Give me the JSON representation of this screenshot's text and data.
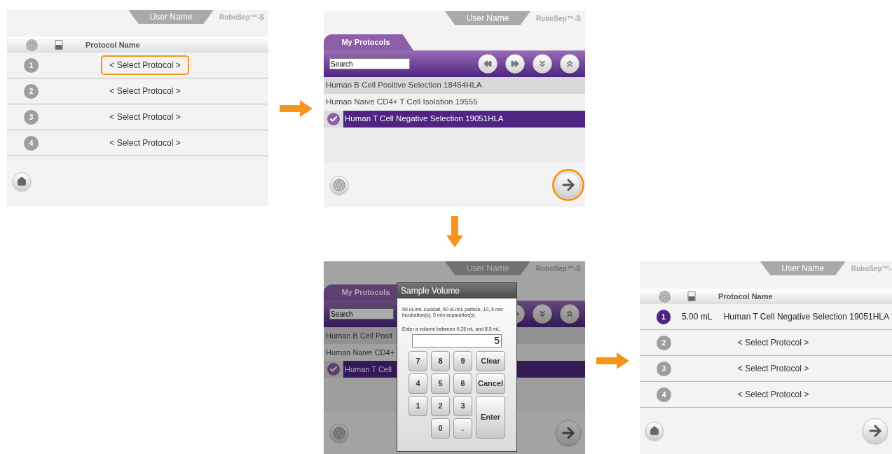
{
  "screens": [
    {
      "kind": "carousel",
      "user_name": "User Name",
      "product": "RoboSep™-S",
      "column": "Protocol Name",
      "next_button": false,
      "rows": [
        {
          "number": "1",
          "protocol": "< Select Protocol >",
          "selected": false,
          "highlighted": true
        },
        {
          "number": "2",
          "protocol": "< Select Protocol >",
          "selected": false,
          "highlighted": false
        },
        {
          "number": "3",
          "protocol": "< Select Protocol >",
          "selected": false,
          "highlighted": false
        },
        {
          "number": "4",
          "protocol": "< Select Protocol >",
          "selected": false,
          "highlighted": false
        }
      ]
    },
    {
      "kind": "browser",
      "user_name": "User Name",
      "product": "RoboSep™-S",
      "tab": "My Protocols",
      "search": {
        "placeholder": "Search"
      },
      "next_highlighted": true,
      "protocols": [
        {
          "name": "Human B Cell Positive Selection 18454HLA",
          "selected": false
        },
        {
          "name": "Human Naive CD4+ T Cell Isolation 19555",
          "selected": false
        },
        {
          "name": "Human T Cell Negative Selection 19051HLA",
          "selected": true
        }
      ]
    },
    {
      "kind": "browser",
      "user_name": "User Name",
      "product": "RoboSep™-S",
      "tab": "My Protocols",
      "search": {
        "placeholder": "Search"
      },
      "next_highlighted": false,
      "protocols": [
        {
          "name": "Human B Cell Posit",
          "selected": false
        },
        {
          "name": "Human Naive CD4+",
          "selected": false
        },
        {
          "name": "Human T Cell",
          "selected": true
        }
      ],
      "dialog": {
        "title": "Sample Volume",
        "description": "50 uL/mL cocktail, 50 uL/mL particle, 10, 5 min incubation(s), 5 min separation(s)",
        "prompt": "Enter a volume between 0.25 mL and 8.5 mL",
        "value": "5",
        "digit_keys": [
          [
            "7",
            "8",
            "9"
          ],
          [
            "4",
            "5",
            "6"
          ],
          [
            "1",
            "2",
            "3"
          ],
          [
            "0",
            "."
          ]
        ],
        "action_keys": [
          {
            "label": "Clear",
            "kind": "small"
          },
          {
            "label": "Cancel",
            "kind": "small"
          },
          {
            "label": "Enter",
            "kind": "tall"
          }
        ]
      }
    },
    {
      "kind": "carousel",
      "user_name": "User Name",
      "product": "RoboSep™-",
      "column": "Protocol Name",
      "next_button": true,
      "rows": [
        {
          "number": "1",
          "volume": "5.00 mL",
          "protocol": "Human T Cell Negative Selection 19051HLA",
          "selected": true,
          "highlighted": false
        },
        {
          "number": "2",
          "protocol": "< Select Protocol >",
          "selected": false,
          "highlighted": false
        },
        {
          "number": "3",
          "protocol": "< Select Protocol >",
          "selected": false,
          "highlighted": false
        },
        {
          "number": "4",
          "protocol": "< Select Protocol >",
          "selected": false,
          "highlighted": false
        }
      ]
    }
  ]
}
